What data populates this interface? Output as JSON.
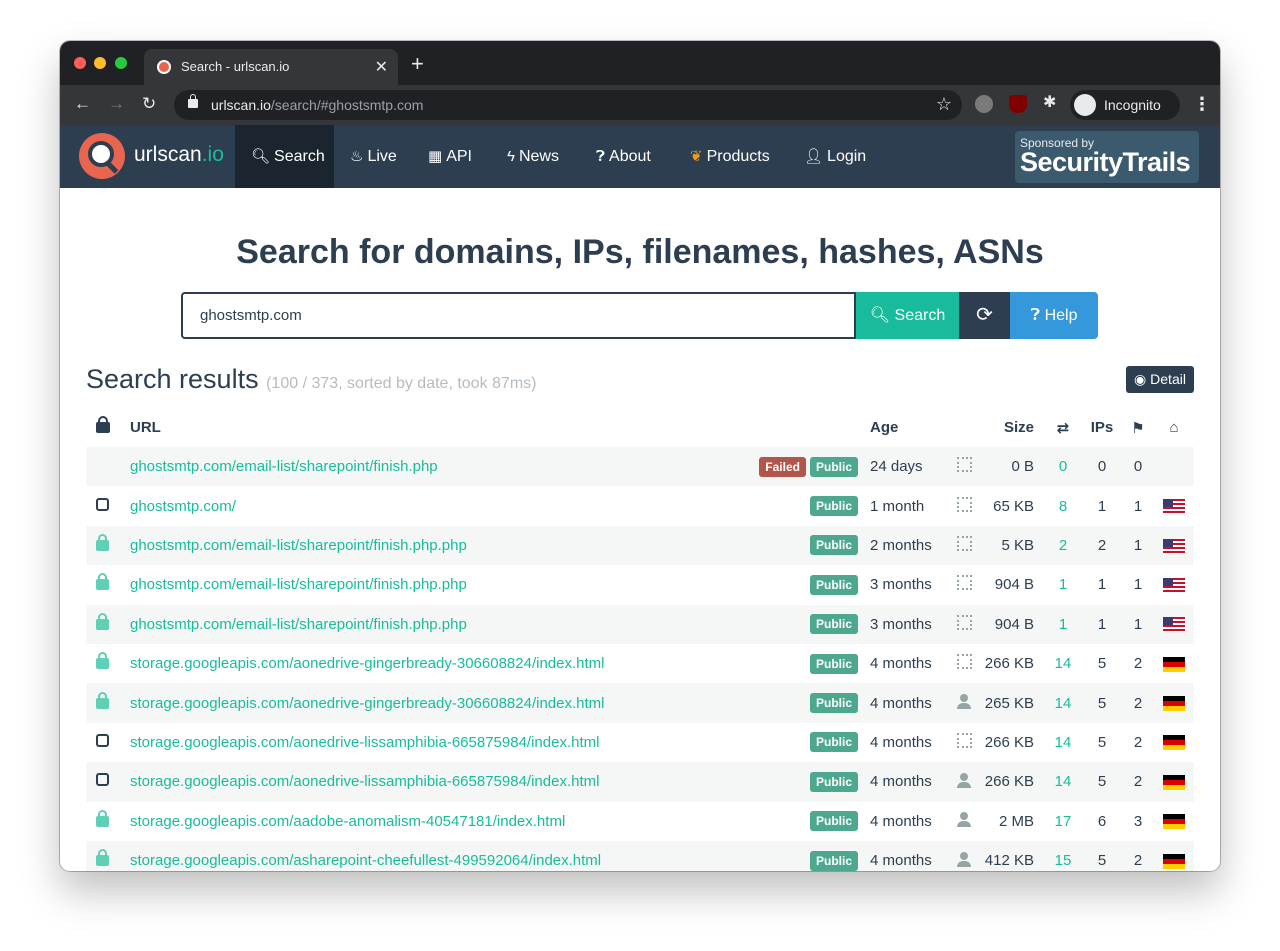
{
  "browser": {
    "tab_title": "Search - urlscan.io",
    "url_host": "urlscan.io",
    "url_path": "/search/#ghostsmtp.com",
    "profile_label": "Incognito"
  },
  "nav": {
    "brand": "urlscan",
    "brand_suffix": ".io",
    "items": [
      {
        "label": "Search",
        "icon": "search-icon",
        "active": true
      },
      {
        "label": "Live",
        "icon": "fire-icon"
      },
      {
        "label": "API",
        "icon": "qrcode-icon"
      },
      {
        "label": "News",
        "icon": "bolt-icon"
      },
      {
        "label": "About",
        "icon": "question-circle-icon"
      },
      {
        "label": "Products",
        "icon": "leaf-icon"
      },
      {
        "label": "Login",
        "icon": "user-icon"
      }
    ],
    "sponsor_small": "Sponsored by",
    "sponsor_brand": "SecurityTrails"
  },
  "search": {
    "headline": "Search for domains, IPs, filenames, hashes, ASNs",
    "value": "ghostsmtp.com",
    "search_label": "Search",
    "help_label": "Help"
  },
  "results": {
    "title": "Search results",
    "meta": "(100 / 373, sorted by date, took 87ms)",
    "detail_label": "Detail",
    "columns": {
      "url": "URL",
      "age": "Age",
      "size": "Size",
      "ips": "IPs"
    },
    "rows": [
      {
        "lock": "none",
        "url": "ghostsmtp.com/email-list/sharepoint/finish.php",
        "failed": "Failed",
        "public": "Public",
        "age": "24 days",
        "source": "qrcode-icon",
        "size": "0 B",
        "requests": "0",
        "ips": "0",
        "countries": "0",
        "flag": ""
      },
      {
        "lock": "unlocked",
        "url": "ghostsmtp.com/",
        "failed": "",
        "public": "Public",
        "age": "1 month",
        "source": "qrcode-icon",
        "size": "65 KB",
        "requests": "8",
        "ips": "1",
        "countries": "1",
        "flag": "us"
      },
      {
        "lock": "locked",
        "url": "ghostsmtp.com/email-list/sharepoint/finish.php.php",
        "failed": "",
        "public": "Public",
        "age": "2 months",
        "source": "qrcode-icon",
        "size": "5 KB",
        "requests": "2",
        "ips": "2",
        "countries": "1",
        "flag": "us"
      },
      {
        "lock": "locked",
        "url": "ghostsmtp.com/email-list/sharepoint/finish.php.php",
        "failed": "",
        "public": "Public",
        "age": "3 months",
        "source": "qrcode-icon",
        "size": "904 B",
        "requests": "1",
        "ips": "1",
        "countries": "1",
        "flag": "us"
      },
      {
        "lock": "locked",
        "url": "ghostsmtp.com/email-list/sharepoint/finish.php.php",
        "failed": "",
        "public": "Public",
        "age": "3 months",
        "source": "qrcode-icon",
        "size": "904 B",
        "requests": "1",
        "ips": "1",
        "countries": "1",
        "flag": "us"
      },
      {
        "lock": "locked",
        "url": "storage.googleapis.com/aonedrive-gingerbready-306608824/index.html",
        "failed": "",
        "public": "Public",
        "age": "4 months",
        "source": "qrcode-icon",
        "size": "266 KB",
        "requests": "14",
        "ips": "5",
        "countries": "2",
        "flag": "de"
      },
      {
        "lock": "locked",
        "url": "storage.googleapis.com/aonedrive-gingerbready-306608824/index.html",
        "failed": "",
        "public": "Public",
        "age": "4 months",
        "source": "user-icon",
        "size": "265 KB",
        "requests": "14",
        "ips": "5",
        "countries": "2",
        "flag": "de"
      },
      {
        "lock": "unlocked",
        "url": "storage.googleapis.com/aonedrive-lissamphibia-665875984/index.html",
        "failed": "",
        "public": "Public",
        "age": "4 months",
        "source": "qrcode-icon",
        "size": "266 KB",
        "requests": "14",
        "ips": "5",
        "countries": "2",
        "flag": "de"
      },
      {
        "lock": "unlocked",
        "url": "storage.googleapis.com/aonedrive-lissamphibia-665875984/index.html",
        "failed": "",
        "public": "Public",
        "age": "4 months",
        "source": "user-icon",
        "size": "266 KB",
        "requests": "14",
        "ips": "5",
        "countries": "2",
        "flag": "de"
      },
      {
        "lock": "locked",
        "url": "storage.googleapis.com/aadobe-anomalism-40547181/index.html",
        "failed": "",
        "public": "Public",
        "age": "4 months",
        "source": "user-icon",
        "size": "2 MB",
        "requests": "17",
        "ips": "6",
        "countries": "3",
        "flag": "de"
      },
      {
        "lock": "locked",
        "url": "storage.googleapis.com/asharepoint-cheefullest-499592064/index.html",
        "failed": "",
        "public": "Public",
        "age": "4 months",
        "source": "user-icon",
        "size": "412 KB",
        "requests": "15",
        "ips": "5",
        "countries": "2",
        "flag": "de"
      }
    ]
  }
}
